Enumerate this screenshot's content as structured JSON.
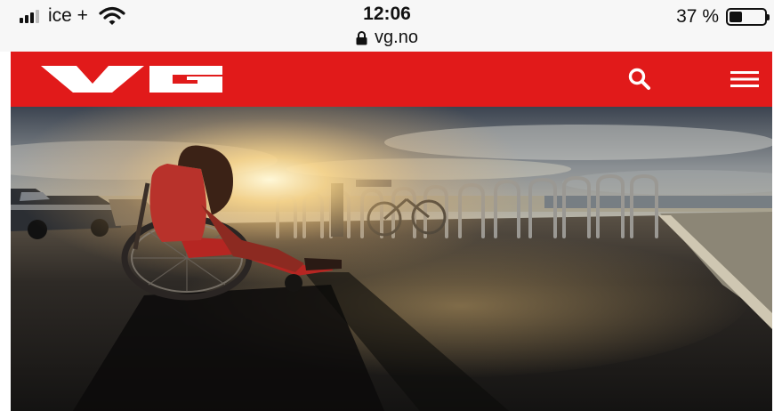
{
  "status_bar": {
    "carrier": "ice +",
    "time": "12:06",
    "url": "vg.no",
    "battery_text": "37 %",
    "battery_level": 0.37
  },
  "header": {
    "logo_text": "VG",
    "brand_color": "#e11a1a"
  },
  "icons": {
    "search": "search-icon",
    "menu": "hamburger-menu-icon",
    "lock": "lock-icon",
    "wifi": "wifi-icon"
  }
}
